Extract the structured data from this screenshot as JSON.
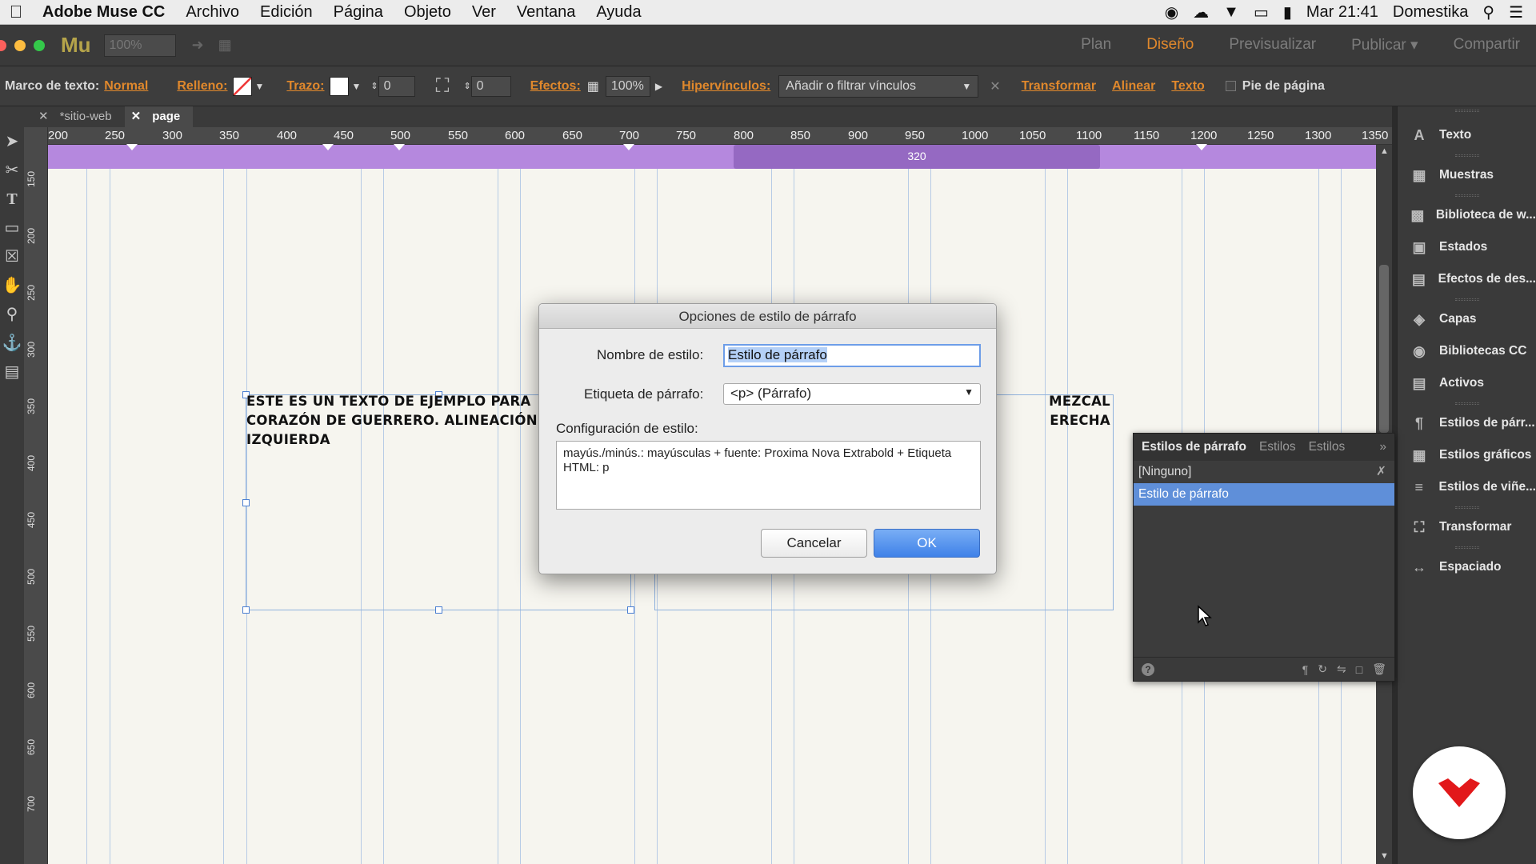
{
  "menubar": {
    "app_name": "Adobe Muse CC",
    "items": [
      "Archivo",
      "Edición",
      "Página",
      "Objeto",
      "Ver",
      "Ventana",
      "Ayuda"
    ],
    "clock": "Mar 21:41",
    "user": "Domestika"
  },
  "appbar": {
    "logo": "Mu",
    "zoom": "100%",
    "modes": [
      "Plan",
      "Diseño",
      "Previsualizar",
      "Publicar",
      "Compartir"
    ],
    "active_mode": "Diseño"
  },
  "control": {
    "frame_label": "Marco de texto:",
    "frame_value": "Normal",
    "fill_label": "Relleno:",
    "stroke_label": "Trazo:",
    "stroke_value": "0",
    "corner_value": "0",
    "effects_label": "Efectos:",
    "opacity": "100%",
    "links_label": "Hipervínculos:",
    "links_placeholder": "Añadir o filtrar vínculos",
    "transform": "Transformar",
    "align": "Alinear",
    "text": "Texto",
    "footer": "Pie de página"
  },
  "tabs": [
    {
      "label": "*sitio-web",
      "active": false
    },
    {
      "label": "page",
      "active": true
    }
  ],
  "ruler": {
    "h_labels": [
      "200",
      "250",
      "300",
      "350",
      "400",
      "450",
      "500",
      "550",
      "600",
      "650",
      "700",
      "750",
      "800",
      "850",
      "900",
      "950",
      "1000",
      "1050",
      "1100",
      "1150",
      "1200",
      "1250",
      "1300",
      "1350"
    ],
    "v_labels": [
      "150",
      "200",
      "250",
      "300",
      "350",
      "400",
      "450",
      "500",
      "550",
      "600",
      "650",
      "700"
    ],
    "breakpoint_label": "320"
  },
  "canvas": {
    "sample_left": [
      "ESTE ES UN TEXTO DE EJEMPLO PARA",
      "CORAZÓN DE GUERRERO. ALINEACIÓN",
      "IZQUIERDA"
    ],
    "sample_right": [
      "MEZCAL",
      "ERECHA"
    ]
  },
  "dialog": {
    "title": "Opciones de estilo de párrafo",
    "name_label": "Nombre de estilo:",
    "name_value": "Estilo de párrafo",
    "tag_label": "Etiqueta de párrafo:",
    "tag_value": "<p> (Párrafo)",
    "config_label": "Configuración de estilo:",
    "config_text": "mayús./minús.: mayúsculas + fuente: Proxima Nova Extrabold + Etiqueta HTML: p",
    "cancel": "Cancelar",
    "ok": "OK"
  },
  "paragraph_panel": {
    "tabs": [
      "Estilos de párrafo",
      "Estilos",
      "Estilos"
    ],
    "items": [
      "[Ninguno]",
      "Estilo de párrafo"
    ],
    "selected": "Estilo de párrafo"
  },
  "dock": [
    {
      "label": "Texto",
      "icon": "text-icon"
    },
    {
      "label": "Muestras",
      "icon": "swatches-icon"
    },
    {
      "label": "Biblioteca de w...",
      "icon": "widgets-library-icon"
    },
    {
      "label": "Estados",
      "icon": "states-icon"
    },
    {
      "label": "Efectos de des...",
      "icon": "scroll-effects-icon"
    },
    {
      "label": "Capas",
      "icon": "layers-icon"
    },
    {
      "label": "Bibliotecas CC",
      "icon": "cc-libraries-icon"
    },
    {
      "label": "Activos",
      "icon": "assets-icon"
    },
    {
      "label": "Estilos de párr...",
      "icon": "paragraph-styles-icon"
    },
    {
      "label": "Estilos gráficos",
      "icon": "graphic-styles-icon"
    },
    {
      "label": "Estilos de viñe...",
      "icon": "bullet-styles-icon"
    },
    {
      "label": "Transformar",
      "icon": "transform-icon"
    },
    {
      "label": "Espaciado",
      "icon": "spacing-icon"
    }
  ],
  "colors": {
    "accent": "#e0882c",
    "breakpoint": "#b588de",
    "selection": "#5f8fd9"
  }
}
